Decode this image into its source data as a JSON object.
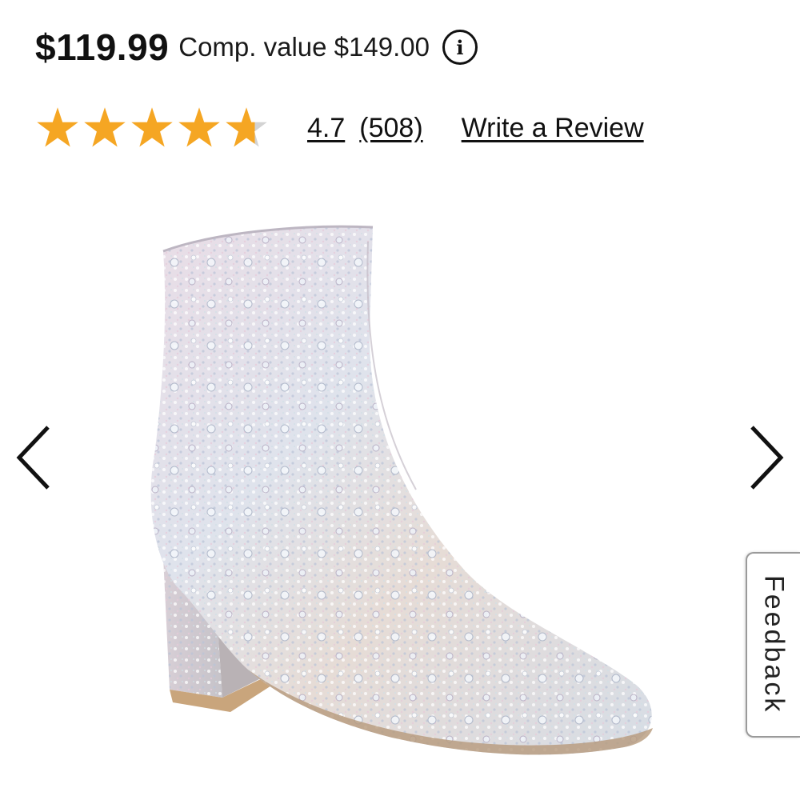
{
  "pricing": {
    "price": "$119.99",
    "comp_value": "Comp. value $149.00",
    "info_icon": "info-circle-icon"
  },
  "rating": {
    "stars_value": 4.7,
    "stars_max": 5,
    "star_color": "#f5a623",
    "empty_star_color": "#d3d3d3",
    "value_label": "4.7",
    "count_label": "(508)",
    "write_review_label": "Write a Review"
  },
  "carousel": {
    "prev_icon": "chevron-left-icon",
    "next_icon": "chevron-right-icon"
  },
  "feedback": {
    "label": "Feedback"
  }
}
